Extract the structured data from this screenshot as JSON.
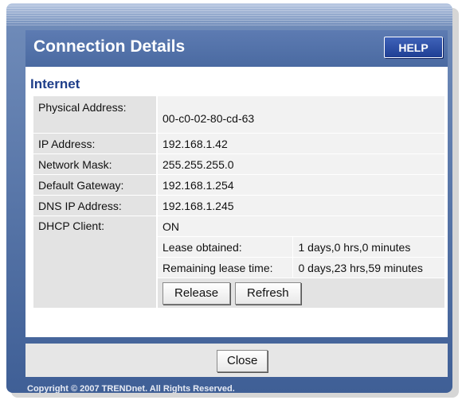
{
  "header": {
    "title": "Connection Details",
    "help_label": "HELP"
  },
  "section": {
    "title": "Internet"
  },
  "rows": {
    "physical_address": {
      "label": "Physical Address:",
      "value": "00-c0-02-80-cd-63"
    },
    "ip_address": {
      "label": "IP Address:",
      "value": "192.168.1.42"
    },
    "network_mask": {
      "label": "Network Mask:",
      "value": "255.255.255.0"
    },
    "default_gateway": {
      "label": "Default Gateway:",
      "value": "192.168.1.254"
    },
    "dns_ip_address": {
      "label": "DNS IP Address:",
      "value": "192.168.1.245"
    },
    "dhcp_client": {
      "label": "DHCP Client:",
      "value": "ON"
    },
    "lease_obtained": {
      "label": "Lease obtained:",
      "value": "1 days,0 hrs,0 minutes"
    },
    "remaining_lease": {
      "label": "Remaining lease time:",
      "value": "0 days,23 hrs,59 minutes"
    }
  },
  "actions": {
    "release_label": "Release",
    "refresh_label": "Refresh"
  },
  "footer": {
    "close_label": "Close",
    "copyright": "Copyright © 2007 TRENDnet. All Rights Reserved."
  },
  "colors": {
    "frame": "#4a6aa0",
    "title_bar": "#5575ad",
    "help_button": "#2a4aa0",
    "section_title": "#1f3f8a"
  }
}
